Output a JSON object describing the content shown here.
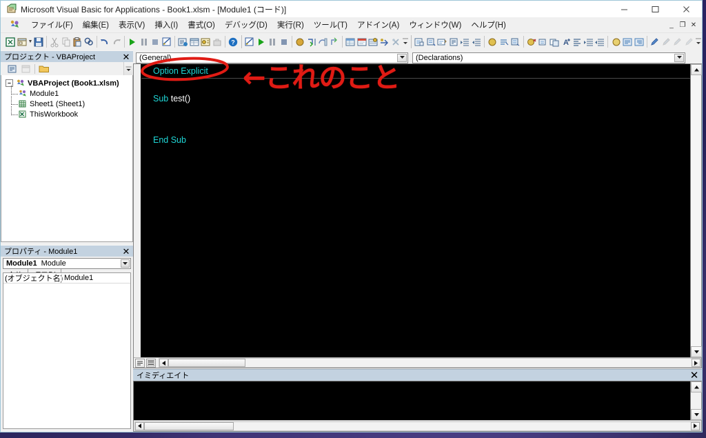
{
  "window": {
    "title": "Microsoft Visual Basic for Applications - Book1.xlsm - [Module1 (コード)]",
    "minimize_label": "—",
    "maximize_label": "□",
    "close_label": "✕",
    "inner_minimize_label": "_",
    "inner_restore_label": "❐",
    "inner_close_label": "✕"
  },
  "menu": {
    "items": [
      {
        "label": "ファイル(F)",
        "accel": "F"
      },
      {
        "label": "編集(E)",
        "accel": "E"
      },
      {
        "label": "表示(V)",
        "accel": "V"
      },
      {
        "label": "挿入(I)",
        "accel": "I"
      },
      {
        "label": "書式(O)",
        "accel": "O"
      },
      {
        "label": "デバッグ(D)",
        "accel": "D"
      },
      {
        "label": "実行(R)",
        "accel": "R"
      },
      {
        "label": "ツール(T)",
        "accel": "T"
      },
      {
        "label": "アドイン(A)",
        "accel": "A"
      },
      {
        "label": "ウィンドウ(W)",
        "accel": "W"
      },
      {
        "label": "ヘルプ(H)",
        "accel": "H"
      }
    ]
  },
  "toolbar": {
    "icons": [
      "view-excel-icon",
      "view-object-icon",
      "save-icon",
      "cut-icon",
      "copy-icon",
      "paste-icon",
      "find-icon",
      "undo-icon",
      "redo-icon",
      "run-icon",
      "break-icon",
      "reset-icon",
      "design-mode-icon",
      "project-explorer-icon",
      "properties-window-icon",
      "object-browser-icon",
      "toolbox-icon",
      "help-icon"
    ],
    "second_group": [
      "design-icon2",
      "run-icon2",
      "pause-icon2",
      "stop-icon2",
      "breakpoint-icon",
      "step-into-icon",
      "step-over-icon",
      "step-out-icon",
      "locals-window-icon",
      "immediate-window-icon",
      "watch-window-icon",
      "quick-watch-icon",
      "call-stack-icon"
    ],
    "third_group": [
      "complete-word-icon",
      "quick-info-icon",
      "parameter-info-icon",
      "list-constants-icon",
      "indent-icon",
      "outdent-icon",
      "toggle-bookmark-icon",
      "next-bookmark-icon",
      "prev-bookmark-icon",
      "clear-bookmarks-icon"
    ]
  },
  "project_explorer": {
    "title": "プロジェクト - VBAProject",
    "close_label": "✕",
    "tools": [
      "view-code-icon",
      "view-object-icon",
      "toggle-folders-icon"
    ],
    "tree": [
      {
        "label": "VBAProject (Book1.xlsm)",
        "icon": "vba-project-icon",
        "level": 0,
        "expanded": true
      },
      {
        "label": "Module1",
        "icon": "module-icon",
        "level": 1
      },
      {
        "label": "Sheet1 (Sheet1)",
        "icon": "worksheet-icon",
        "level": 1
      },
      {
        "label": "ThisWorkbook",
        "icon": "workbook-icon",
        "level": 1
      }
    ]
  },
  "properties": {
    "title": "プロパティ - Module1",
    "close_label": "✕",
    "object_name": "Module1",
    "object_type": "Module",
    "tabs": [
      {
        "label": "全体",
        "active": true
      },
      {
        "label": "項目別",
        "active": false
      }
    ],
    "rows": [
      {
        "key": "(オブジェクト名)",
        "value": "Module1"
      }
    ]
  },
  "code_window": {
    "procedure_combo": "(General)",
    "declaration_combo": "(Declarations)",
    "lines": [
      {
        "segments": [
          {
            "text": "Option Explicit",
            "style": "kw"
          }
        ]
      },
      {
        "segments": []
      },
      {
        "segments": [
          {
            "text": "Sub ",
            "style": "kw"
          },
          {
            "text": "test()",
            "style": "id"
          }
        ]
      },
      {
        "segments": []
      },
      {
        "segments": []
      },
      {
        "segments": [
          {
            "text": "End Sub",
            "style": "kw"
          }
        ]
      }
    ],
    "colors": {
      "background": "#000000",
      "keyword": "#1fd6d6",
      "identifier": "#ffffff"
    },
    "view_buttons": [
      "procedure-view-icon",
      "full-module-view-icon"
    ]
  },
  "immediate_window": {
    "title": "イミディエイト",
    "close_label": "✕",
    "content": ""
  },
  "annotation": {
    "text": "←これのこと",
    "color": "#e01b14",
    "ellipse_target": "Option Explicit"
  }
}
